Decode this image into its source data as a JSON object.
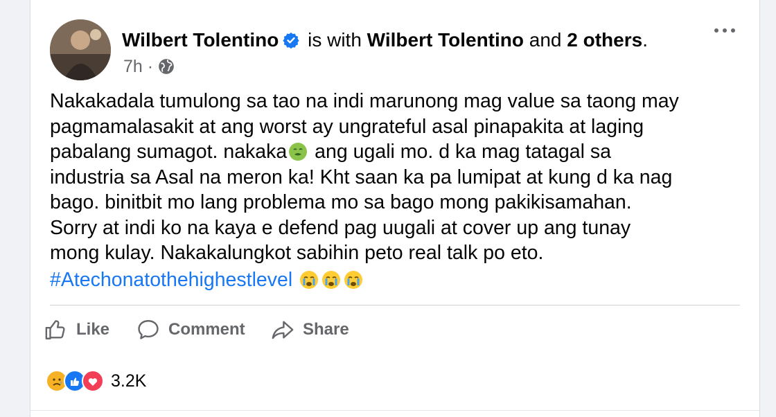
{
  "post": {
    "author": "Wilbert Tolentino",
    "with_text": "is with",
    "tagged": "Wilbert Tolentino",
    "and_text": "and",
    "others": "2 others",
    "period": ".",
    "time": "7h",
    "dot": "·",
    "body_part1": "Nakakadala tumulong sa tao na indi marunong mag value sa taong may\npagmamalasakit at ang worst ay ungrateful asal pinapakita at laging\npabalang sumagot. nakaka",
    "body_part2": " ang ugali mo. d ka mag tatagal sa\nindustria sa Asal na meron ka! Kht saan ka pa lumipat at kung d ka nag\nbago. binitbit mo lang problema mo sa bago mong pakikisamahan.\nSorry at indi ko na kaya e defend pag uugali at cover up ang tunay\nmong kulay. Nakakalungkot sabihin peto real talk po eto.",
    "hashtag": "#Atechonatothehighestlevel",
    "icons": [
      "verified-badge-icon",
      "globe-icon",
      "more-options-icon",
      "nauseated-face-emoji",
      "crying-face-emoji",
      "like-icon",
      "comment-icon",
      "share-icon",
      "sad-reaction-icon",
      "like-reaction-icon",
      "love-reaction-icon"
    ]
  },
  "actions": {
    "like": "Like",
    "comment": "Comment",
    "share": "Share"
  },
  "reactions": {
    "count": "3.2K"
  },
  "colors": {
    "link": "#1877f2",
    "secondary_text": "#65676b",
    "background": "#f0f2f5"
  }
}
